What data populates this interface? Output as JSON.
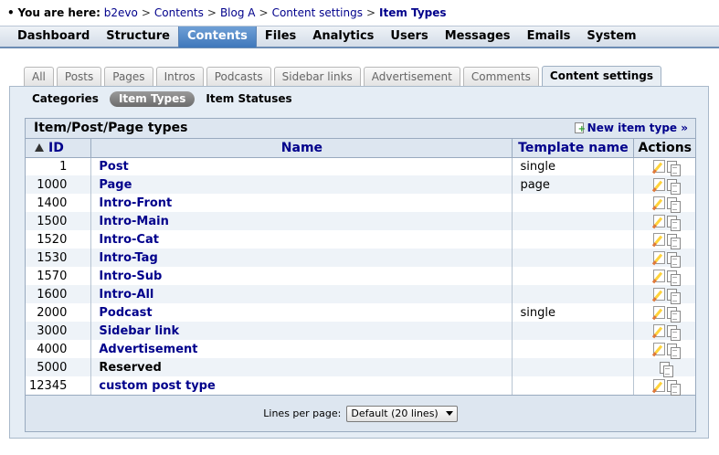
{
  "breadcrumb": {
    "bullet": "•",
    "lead": "You are here:",
    "items": [
      "b2evo",
      "Contents",
      "Blog A",
      "Content settings",
      "Item Types"
    ],
    "separator": ">"
  },
  "mainmenu": {
    "items": [
      "Dashboard",
      "Structure",
      "Contents",
      "Files",
      "Analytics",
      "Users",
      "Messages",
      "Emails",
      "System"
    ],
    "active": "Contents"
  },
  "tabs": {
    "items": [
      "All",
      "Posts",
      "Pages",
      "Intros",
      "Podcasts",
      "Sidebar links",
      "Advertisement",
      "Comments",
      "Content settings"
    ],
    "active": "Content settings"
  },
  "subtabs": {
    "items": [
      "Categories",
      "Item Types",
      "Item Statuses"
    ],
    "active": "Item Types"
  },
  "results": {
    "title": "Item/Post/Page types",
    "new_link": "New item type »",
    "columns": {
      "id": "ID",
      "name": "Name",
      "template": "Template name",
      "actions": "Actions"
    },
    "rows": [
      {
        "id": "1",
        "name": "Post",
        "template": "single",
        "link": true,
        "editable": true
      },
      {
        "id": "1000",
        "name": "Page",
        "template": "page",
        "link": true,
        "editable": true
      },
      {
        "id": "1400",
        "name": "Intro-Front",
        "template": "",
        "link": true,
        "editable": true
      },
      {
        "id": "1500",
        "name": "Intro-Main",
        "template": "",
        "link": true,
        "editable": true
      },
      {
        "id": "1520",
        "name": "Intro-Cat",
        "template": "",
        "link": true,
        "editable": true
      },
      {
        "id": "1530",
        "name": "Intro-Tag",
        "template": "",
        "link": true,
        "editable": true
      },
      {
        "id": "1570",
        "name": "Intro-Sub",
        "template": "",
        "link": true,
        "editable": true
      },
      {
        "id": "1600",
        "name": "Intro-All",
        "template": "",
        "link": true,
        "editable": true
      },
      {
        "id": "2000",
        "name": "Podcast",
        "template": "single",
        "link": true,
        "editable": true
      },
      {
        "id": "3000",
        "name": "Sidebar link",
        "template": "",
        "link": true,
        "editable": true
      },
      {
        "id": "4000",
        "name": "Advertisement",
        "template": "",
        "link": true,
        "editable": true
      },
      {
        "id": "5000",
        "name": "Reserved",
        "template": "",
        "link": false,
        "editable": false
      },
      {
        "id": "12345",
        "name": "custom post type",
        "template": "",
        "link": true,
        "editable": true
      }
    ],
    "lines_per_page_label": "Lines per page:",
    "lines_per_page_value": "Default (20 lines)"
  },
  "icons": {
    "sort": "sort-ascending-icon",
    "new": "new-document-icon",
    "edit": "edit-icon",
    "copy": "copy-icon"
  },
  "colors": {
    "link": "#00008b",
    "menu_active": "#3f77bb",
    "panel_bg": "#e5edf5",
    "row_alt": "#eef3f8"
  }
}
